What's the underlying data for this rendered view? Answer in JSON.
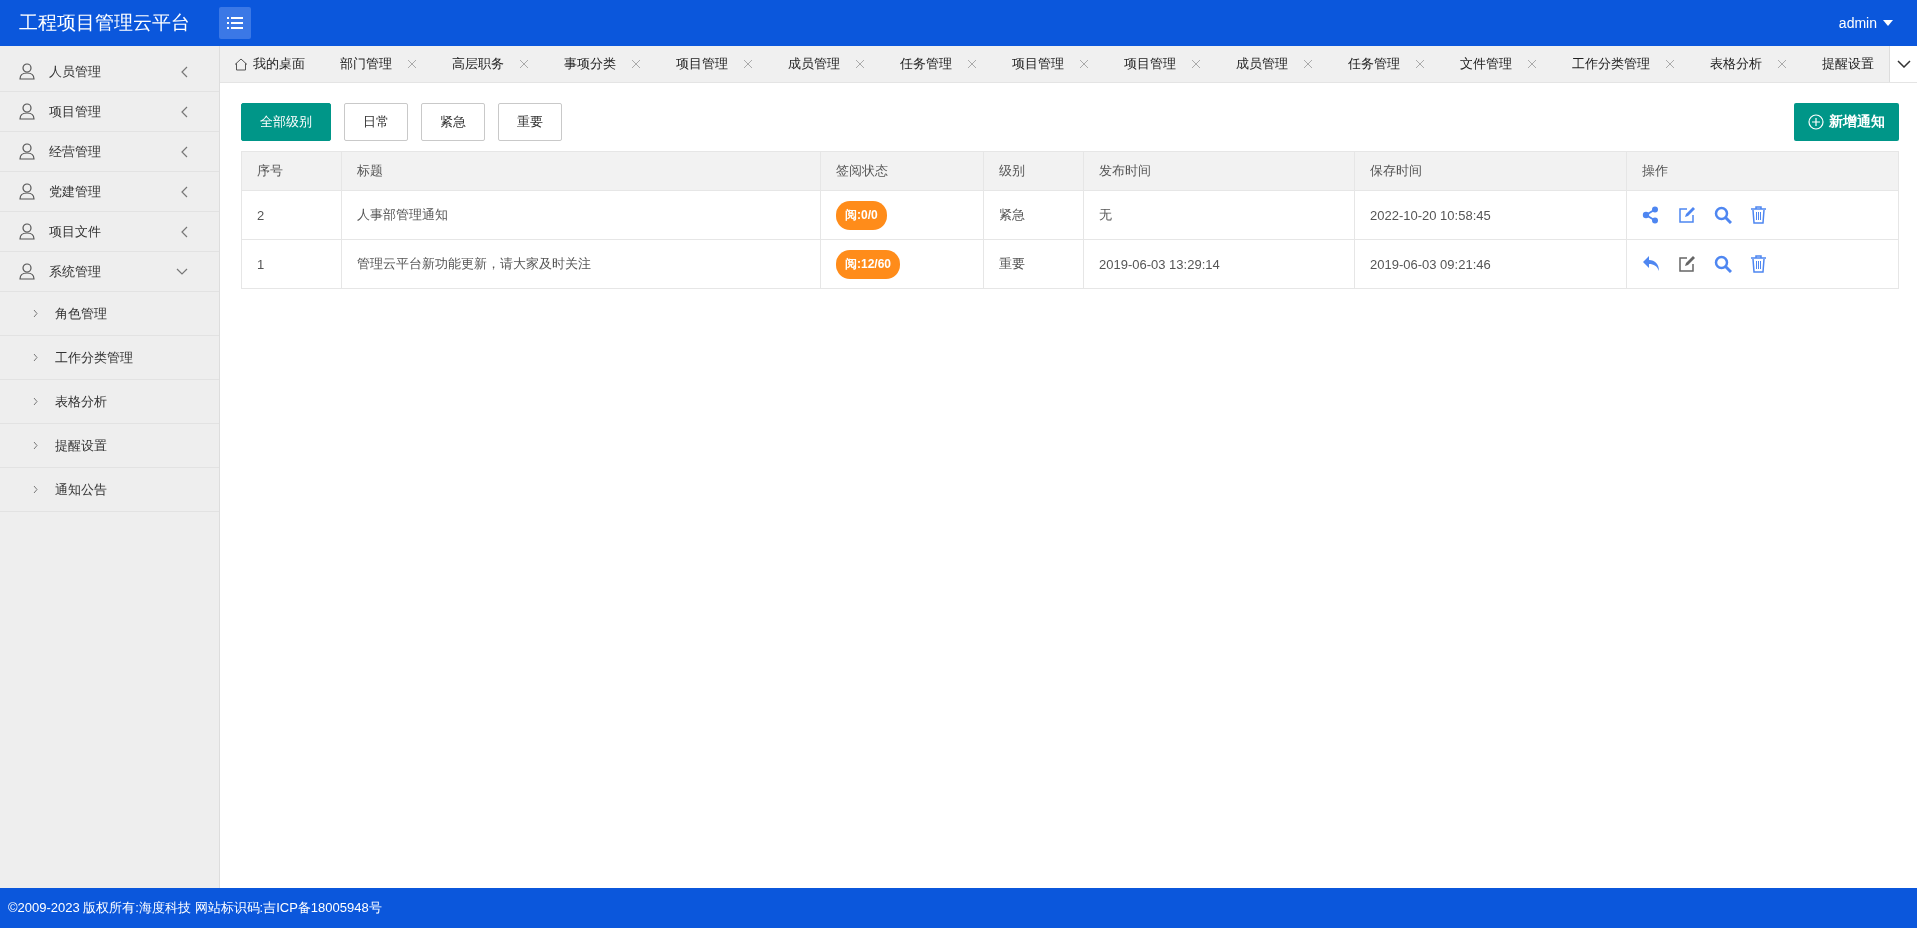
{
  "header": {
    "title": "工程项目管理云平台",
    "user": "admin"
  },
  "sidebar": {
    "items": [
      {
        "label": "人员管理",
        "expanded": false
      },
      {
        "label": "项目管理",
        "expanded": false
      },
      {
        "label": "经营管理",
        "expanded": false
      },
      {
        "label": "党建管理",
        "expanded": false
      },
      {
        "label": "项目文件",
        "expanded": false
      },
      {
        "label": "系统管理",
        "expanded": true,
        "children": [
          {
            "label": "角色管理"
          },
          {
            "label": "工作分类管理"
          },
          {
            "label": "表格分析"
          },
          {
            "label": "提醒设置"
          },
          {
            "label": "通知公告"
          }
        ]
      }
    ]
  },
  "tabs": [
    {
      "label": "我的桌面",
      "kind": "home"
    },
    {
      "label": "部门管理",
      "kind": "closable"
    },
    {
      "label": "高层职务",
      "kind": "closable"
    },
    {
      "label": "事项分类",
      "kind": "closable"
    },
    {
      "label": "项目管理",
      "kind": "closable"
    },
    {
      "label": "成员管理",
      "kind": "closable"
    },
    {
      "label": "任务管理",
      "kind": "closable"
    },
    {
      "label": "项目管理",
      "kind": "closable"
    },
    {
      "label": "项目管理",
      "kind": "closable"
    },
    {
      "label": "成员管理",
      "kind": "closable"
    },
    {
      "label": "任务管理",
      "kind": "closable"
    },
    {
      "label": "文件管理",
      "kind": "closable"
    },
    {
      "label": "工作分类管理",
      "kind": "closable"
    },
    {
      "label": "表格分析",
      "kind": "closable"
    },
    {
      "label": "提醒设置",
      "kind": "plain"
    }
  ],
  "filters": [
    {
      "label": "全部级别",
      "selected": true
    },
    {
      "label": "日常",
      "selected": false
    },
    {
      "label": "紧急",
      "selected": false
    },
    {
      "label": "重要",
      "selected": false
    }
  ],
  "add_button": "新增通知",
  "table": {
    "columns": [
      "序号",
      "标题",
      "签阅状态",
      "级别",
      "发布时间",
      "保存时间",
      "操作"
    ],
    "rows": [
      {
        "no": "2",
        "title": "人事部管理通知",
        "status": "阅:0/0",
        "level": "紧急",
        "published": "无",
        "saved": "2022-10-20 10:58:45",
        "actions": [
          {
            "kind": "share",
            "color": "#4e86f1"
          },
          {
            "kind": "edit",
            "color": "#4e86f1"
          },
          {
            "kind": "search",
            "color": "#4e86f1"
          },
          {
            "kind": "delete",
            "color": "#4e86f1"
          }
        ]
      },
      {
        "no": "1",
        "title": "管理云平台新功能更新，请大家及时关注",
        "status": "阅:12/60",
        "level": "重要",
        "published": "2019-06-03 13:29:14",
        "saved": "2019-06-03 09:21:46",
        "actions": [
          {
            "kind": "reply",
            "color": "#4e86f1"
          },
          {
            "kind": "edit",
            "color": "#666666"
          },
          {
            "kind": "search",
            "color": "#4e86f1"
          },
          {
            "kind": "delete",
            "color": "#4e86f1"
          }
        ]
      }
    ]
  },
  "footer": "©2009-2023 版权所有:海度科技 网站标识码:吉ICP备18005948号"
}
